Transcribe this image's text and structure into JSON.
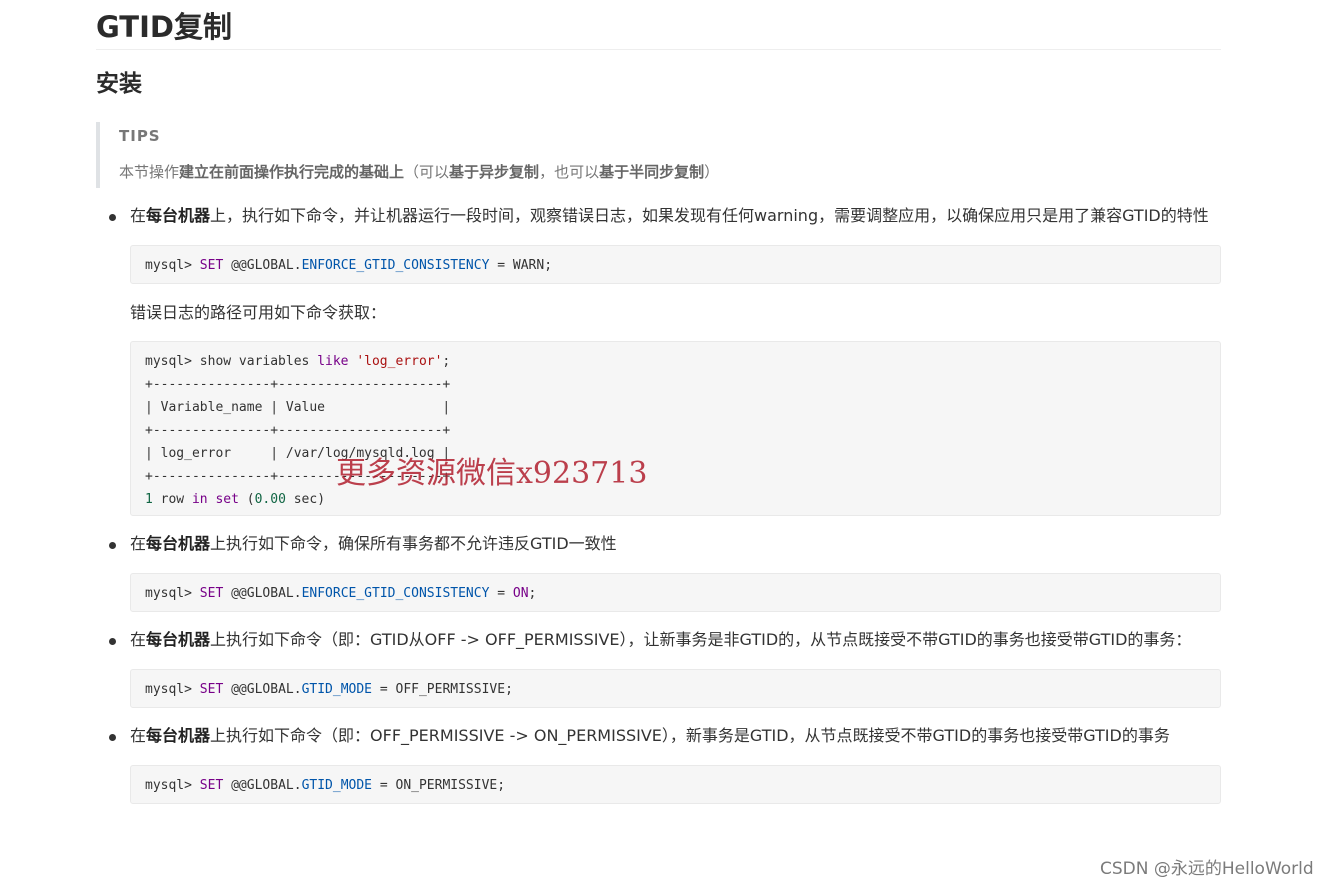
{
  "doc": {
    "title": "GTID复制",
    "section": "安装",
    "tips": {
      "title": "TIPS",
      "text_prefix": "本节操作",
      "text_bold1": "建立在前面操作执行完成的基础上",
      "text_mid": "（可以",
      "text_bold2": "基于异步复制",
      "text_mid2": "，也可以",
      "text_bold3": "基于半同步复制",
      "text_suffix": "）"
    },
    "item1": {
      "prefix": "在",
      "bold": "每台机器",
      "suffix": "上，执行如下命令，并让机器运行一段时间，观察错误日志，如果发现有任何warning，需要调整应用，以确保应用只是用了兼容GTID的特性"
    },
    "code1": {
      "prompt": "mysql> ",
      "kw": "SET",
      "var_prefix": " @@GLOBAL.",
      "var": "ENFORCE_GTID_CONSISTENCY",
      "rest": " = WARN;"
    },
    "para1": "错误日志的路径可用如下命令获取：",
    "code2": {
      "l1_a": "mysql> show variables ",
      "l1_kw": "like",
      "l1_sp": " ",
      "l1_str": "'log_error'",
      "l1_end": ";",
      "l2": "+---------------+---------------------+",
      "l3": "| Variable_name | Value               |",
      "l4": "+---------------+---------------------+",
      "l5": "| log_error     | /var/log/mysqld.log |",
      "l6": "+---------------+---------------------+",
      "l7_num1": "1",
      "l7_a": " row ",
      "l7_kw1": "in",
      "l7_sp": " ",
      "l7_kw2": "set",
      "l7_b": " (",
      "l7_num2": "0.00",
      "l7_c": " sec)"
    },
    "item2": {
      "prefix": "在",
      "bold": "每台机器",
      "suffix": "上执行如下命令，确保所有事务都不允许违反GTID一致性"
    },
    "code3": {
      "prompt": "mysql> ",
      "kw": "SET",
      "var_prefix": " @@GLOBAL.",
      "var": "ENFORCE_GTID_CONSISTENCY",
      "eq": " = ",
      "val": "ON",
      "end": ";"
    },
    "item3": {
      "prefix": "在",
      "bold": "每台机器",
      "suffix": "上执行如下命令（即：GTID从OFF -> OFF_PERMISSIVE），让新事务是非GTID的，从节点既接受不带GTID的事务也接受带GTID的事务："
    },
    "code4": {
      "prompt": "mysql> ",
      "kw": "SET",
      "var_prefix": " @@GLOBAL.",
      "var": "GTID_MODE",
      "rest": " = OFF_PERMISSIVE;"
    },
    "item4": {
      "prefix": "在",
      "bold": "每台机器",
      "suffix": "上执行如下命令（即：OFF_PERMISSIVE -> ON_PERMISSIVE），新事务是GTID，从节点既接受不带GTID的事务也接受带GTID的事务"
    },
    "code5": {
      "prompt": "mysql> ",
      "kw": "SET",
      "var_prefix": " @@GLOBAL.",
      "var": "GTID_MODE",
      "rest": " = ON_PERMISSIVE;"
    }
  },
  "overlay": {
    "watermark": "更多资源微信x923713",
    "credit": "CSDN @永远的HelloWorld"
  }
}
